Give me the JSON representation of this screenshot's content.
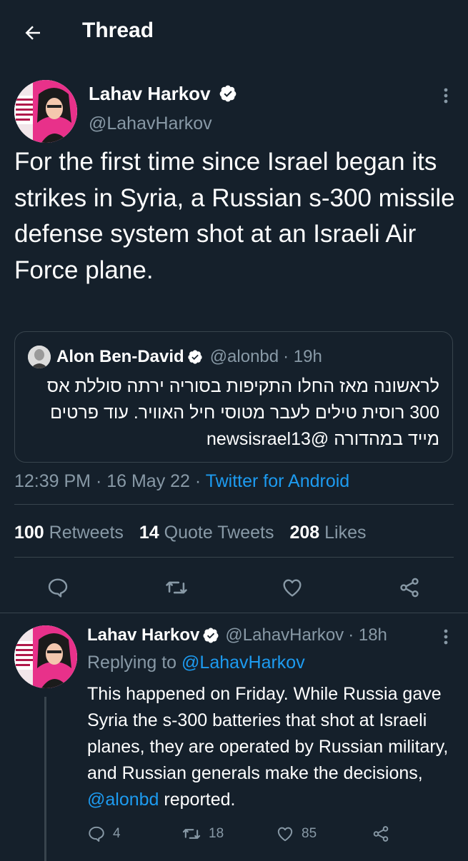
{
  "header": {
    "title": "Thread",
    "back_icon": "arrow-left-icon"
  },
  "main_tweet": {
    "author_name": "Lahav Harkov",
    "handle": "@LahavHarkov",
    "text": "For the first time since Israel began its strikes in Syria, a Russian s-300 missile defense system shot at an Israeli Air Force plane.",
    "quoted": {
      "author_name": "Alon Ben-David",
      "handle": "@alonbd",
      "time": "· 19h",
      "text": "לראשונה מאז החלו התקיפות בסוריה ירתה סוללת אס 300 רוסית טילים לעבר מטוסי חיל האוויר. עוד פרטים מייד במהדורה @newsisrael13"
    },
    "timestamp": "12:39 PM · 16 May 22 ·",
    "client": "Twitter for Android",
    "stats": {
      "retweets_count": "100",
      "retweets_label": "Retweets",
      "quotes_count": "14",
      "quotes_label": "Quote Tweets",
      "likes_count": "208",
      "likes_label": "Likes"
    }
  },
  "reply_tweet": {
    "author_name": "Lahav Harkov",
    "handle": "@LahavHarkov",
    "time": "· 18h",
    "replying_prefix": "Replying to",
    "replying_to": "@LahavHarkov",
    "text_before": "This happened on Friday. While Russia gave Syria the s-300 batteries that shot at Israeli planes, they are operated by Russian military, and Russian generals make the decisions,",
    "mention": "@alonbd",
    "text_after": "reported.",
    "reply_count": "4",
    "retweet_count": "18",
    "like_count": "85"
  },
  "colors": {
    "background": "#15202b",
    "muted": "#8899a6",
    "accent": "#1d9bf0",
    "border": "#38444d"
  }
}
